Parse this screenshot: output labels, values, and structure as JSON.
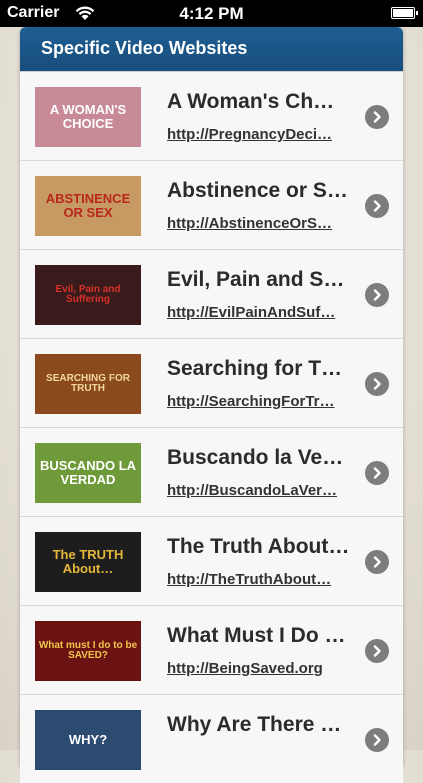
{
  "status_bar": {
    "carrier": "Carrier",
    "time": "4:12 PM"
  },
  "header": {
    "title": "Specific Video Websites"
  },
  "items": [
    {
      "title": "A Woman's Ch…",
      "url": "http://PregnancyDeci…",
      "thumb_text": "A WOMAN'S CHOICE",
      "thumb_bg": "#c98a98",
      "thumb_color": "#ffffff"
    },
    {
      "title": "Abstinence or S…",
      "url": "http://AbstinenceOrS…",
      "thumb_text": "ABSTINENCE OR SEX",
      "thumb_bg": "#c79a63",
      "thumb_color": "#b8271c"
    },
    {
      "title": "Evil, Pain and S…",
      "url": "http://EvilPainAndSuf…",
      "thumb_text": "Evil, Pain and Suffering",
      "thumb_bg": "#3a1b1b",
      "thumb_color": "#d8302a"
    },
    {
      "title": "Searching for T…",
      "url": "http://SearchingForTr…",
      "thumb_text": "SEARCHING FOR TRUTH",
      "thumb_bg": "#8a4a1e",
      "thumb_color": "#f2d7a0"
    },
    {
      "title": "Buscando la Ve…",
      "url": "http://BuscandoLaVer…",
      "thumb_text": "BUSCANDO LA VERDAD",
      "thumb_bg": "#6f9a3a",
      "thumb_color": "#ffffff"
    },
    {
      "title": "The Truth About…",
      "url": "http://TheTruthAbout…",
      "thumb_text": "The TRUTH About…",
      "thumb_bg": "#1d1d1d",
      "thumb_color": "#e4b63a"
    },
    {
      "title": "What Must I Do …",
      "url": "http://BeingSaved.org",
      "thumb_text": "What must I do to be SAVED?",
      "thumb_bg": "#6b1212",
      "thumb_color": "#f0c64b"
    },
    {
      "title": "Why Are There …",
      "url": "",
      "thumb_text": "WHY?",
      "thumb_bg": "#2c4b70",
      "thumb_color": "#ffffff"
    }
  ],
  "colors": {
    "header": "#1f5e93",
    "chevron": "#7d7d7d"
  }
}
